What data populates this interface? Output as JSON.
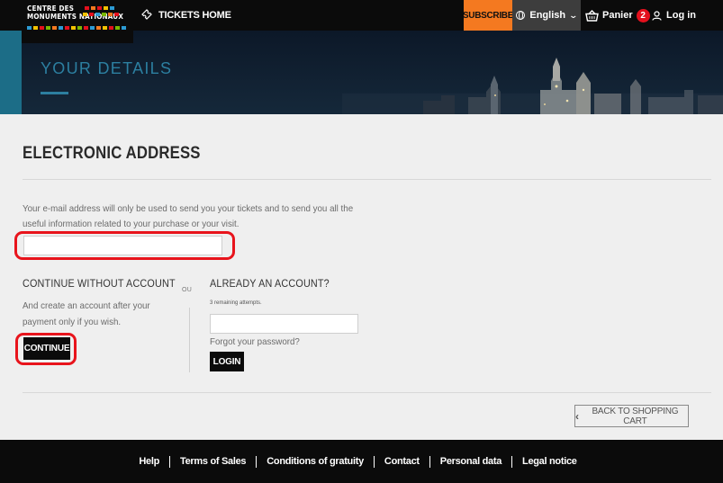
{
  "header": {
    "logo_line1": "CENTRE DES",
    "logo_line2": "MONUMENTS NATIONAUX",
    "tickets_home": "TICKETS HOME",
    "subscribe": "SUBSCRIBE",
    "language": "English",
    "cart_label": "Panier",
    "cart_count": "2",
    "login": "Log in"
  },
  "hero": {
    "title": "YOUR DETAILS"
  },
  "main": {
    "section_title": "ELECTRONIC ADDRESS",
    "info_text": "Your e-mail address will only be used to send you your tickets and to send you all the useful information related to your purchase or your visit.",
    "email_value": "",
    "left": {
      "title": "CONTINUE WITHOUT ACCOUNT",
      "text": "And create an account after your payment only if you wish.",
      "button": "CONTINUE"
    },
    "separator": "OU",
    "right": {
      "title": "ALREADY AN ACCOUNT?",
      "attempts": "3 remaining attempts.",
      "password_value": "",
      "forgot": "Forgot your password?",
      "button": "LOGIN"
    },
    "back_button": "BACK TO SHOPPING CART"
  },
  "footer": {
    "links": [
      "Help",
      "Terms of Sales",
      "Conditions of gratuity",
      "Contact",
      "Personal data",
      "Legal notice"
    ]
  },
  "colors": {
    "accent_orange": "#f47920",
    "hero_blue": "#2c7fa0",
    "badge_red": "#e4101d",
    "annotation_red": "#e8141c"
  }
}
